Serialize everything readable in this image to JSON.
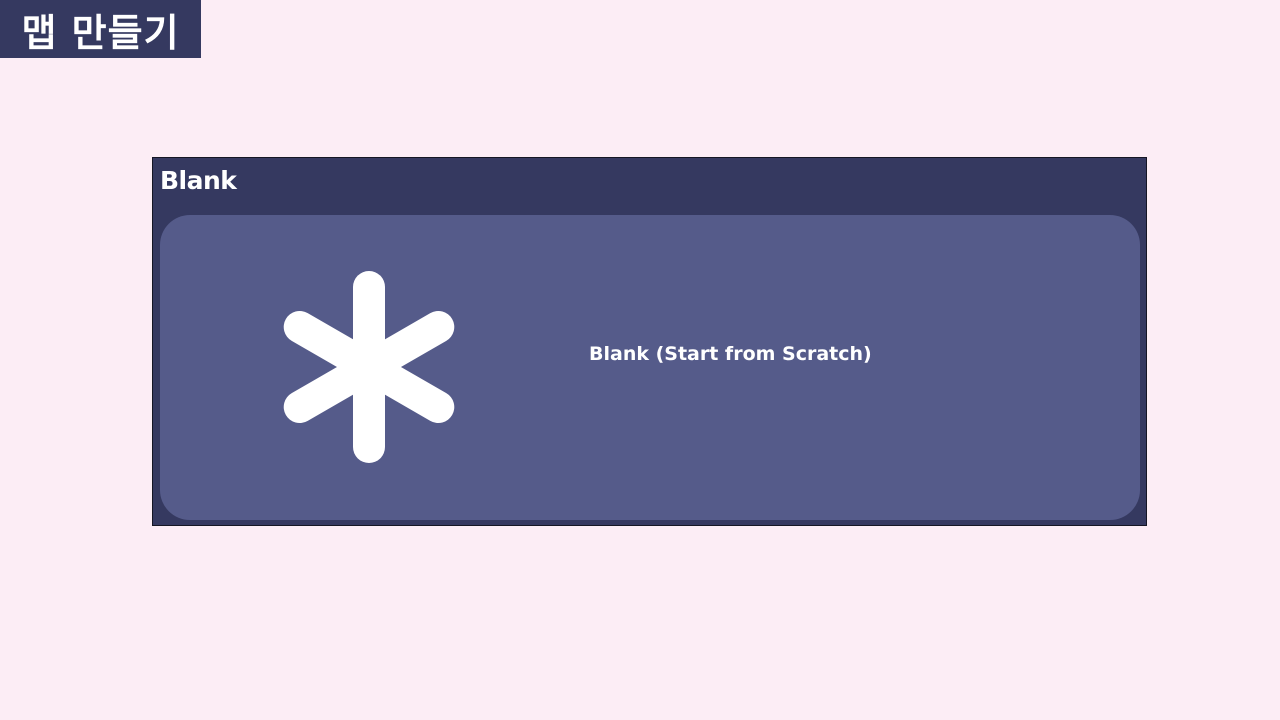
{
  "page": {
    "title": "맵 만들기"
  },
  "section": {
    "heading": "Blank"
  },
  "template_card": {
    "label": "Blank (Start from Scratch)",
    "icon": "asterisk-icon"
  },
  "colors": {
    "background": "#fcedf5",
    "panel": "#353960",
    "card": "#555b8a",
    "text": "#ffffff"
  }
}
